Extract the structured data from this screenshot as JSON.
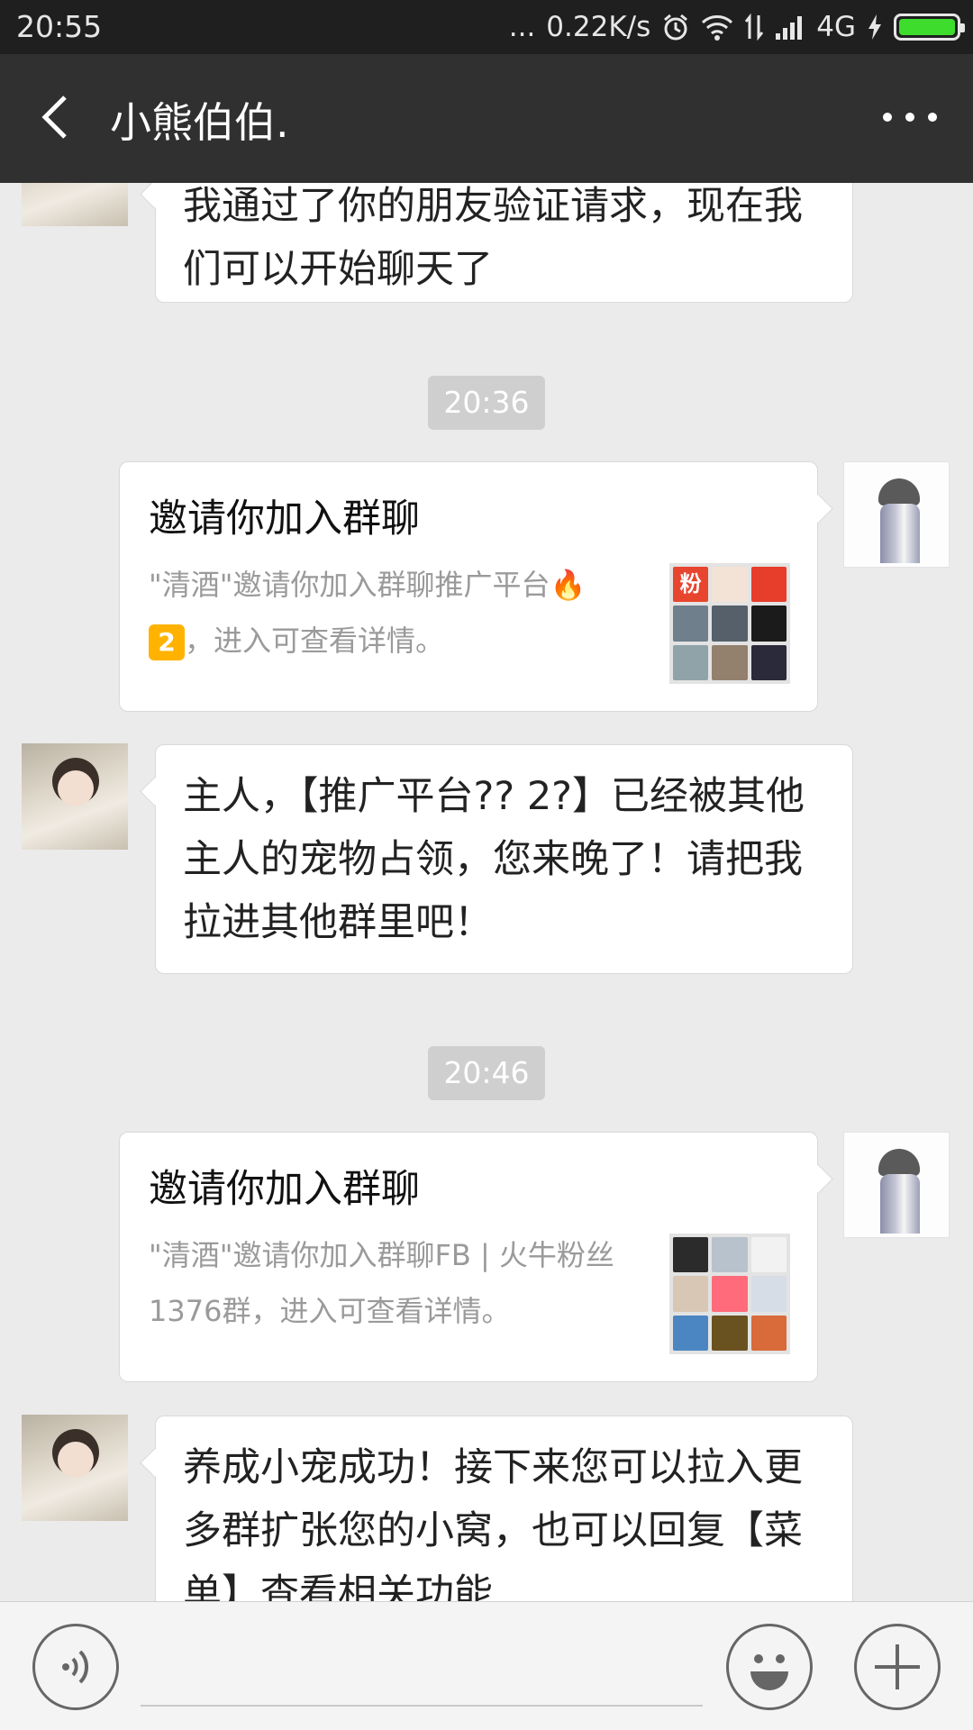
{
  "status_bar": {
    "time": "20:55",
    "dots": "...",
    "speed": "0.22K/s",
    "network": "4G"
  },
  "header": {
    "title": "小熊伯伯."
  },
  "messages": {
    "m0": {
      "text": "我通过了你的朋友验证请求，现在我们可以开始聊天了"
    },
    "ts1": {
      "text": "20:36"
    },
    "inv1": {
      "title": "邀请你加入群聊",
      "desc_prefix": "\"清酒\"邀请你加入群聊推广平台",
      "desc_badge": "2",
      "desc_suffix": "，进入可查看详情。",
      "thumb_label": "粉"
    },
    "m2": {
      "text": "主人，【推广平台?? 2?】已经被其他主人的宠物占领，您来晚了！请把我拉进其他群里吧！"
    },
    "ts2": {
      "text": "20:46"
    },
    "inv2": {
      "title": "邀请你加入群聊",
      "desc": "\"清酒\"邀请你加入群聊FB | 火牛粉丝1376群，进入可查看详情。"
    },
    "m3": {
      "text": "养成小宠成功！接下来您可以拉入更多群扩张您的小窝，也可以回复【菜单】查看相关功能"
    }
  },
  "input": {
    "placeholder": ""
  },
  "colors": {
    "status_bg": "#1f1f1f",
    "title_bg": "#303030",
    "chat_bg": "#ebebeb",
    "timestamp_bg": "#cfcfcf",
    "battery": "#3ddc2d"
  }
}
